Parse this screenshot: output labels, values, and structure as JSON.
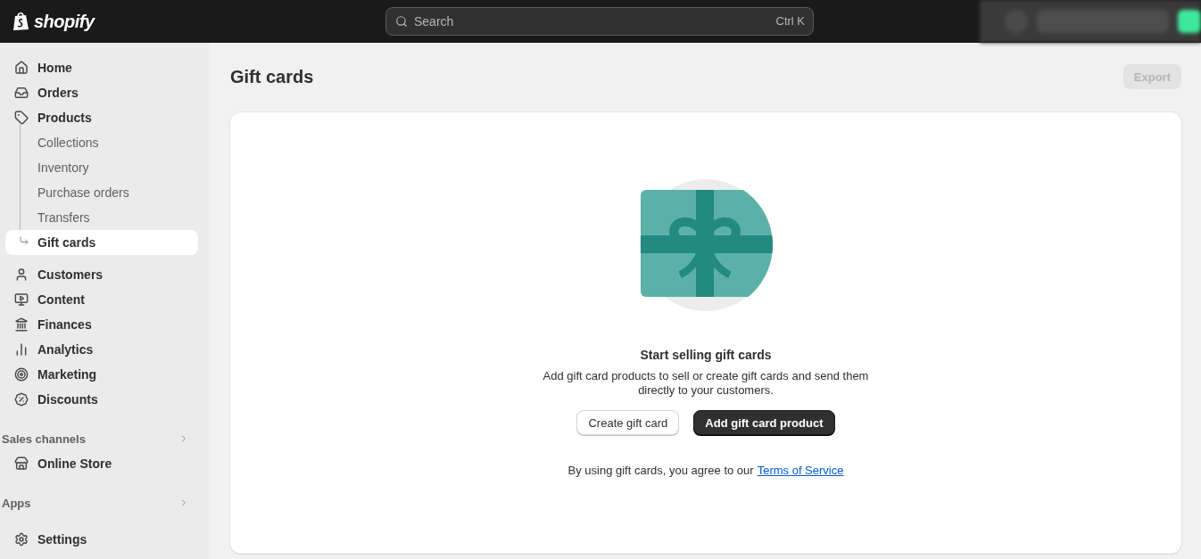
{
  "topbar": {
    "logo": "shopify",
    "search": {
      "placeholder": "Search",
      "shortcut": "Ctrl K"
    }
  },
  "sidebar": {
    "items": [
      {
        "label": "Home",
        "selected": false
      },
      {
        "label": "Orders",
        "selected": false
      },
      {
        "label": "Products",
        "selected": false,
        "children": [
          {
            "label": "Collections",
            "selected": false
          },
          {
            "label": "Inventory",
            "selected": false
          },
          {
            "label": "Purchase orders",
            "selected": false
          },
          {
            "label": "Transfers",
            "selected": false
          },
          {
            "label": "Gift cards",
            "selected": true
          }
        ]
      },
      {
        "label": "Customers",
        "selected": false
      },
      {
        "label": "Content",
        "selected": false
      },
      {
        "label": "Finances",
        "selected": false
      },
      {
        "label": "Analytics",
        "selected": false
      },
      {
        "label": "Marketing",
        "selected": false
      },
      {
        "label": "Discounts",
        "selected": false
      }
    ],
    "sections": [
      {
        "title": "Sales channels",
        "items": [
          {
            "label": "Online Store",
            "selected": false
          }
        ]
      },
      {
        "title": "Apps"
      }
    ],
    "settings": {
      "label": "Settings",
      "selected": false
    }
  },
  "page": {
    "title": "Gift cards",
    "export_button": {
      "label": "Export",
      "disabled": true
    }
  },
  "empty_state": {
    "heading": "Start selling gift cards",
    "text": "Add gift card products to sell or create gift cards and send them directly to your customers.",
    "buttons": [
      {
        "label": "Create gift card",
        "kind": "secondary"
      },
      {
        "label": "Add gift card product",
        "kind": "primary"
      }
    ],
    "terms": {
      "text": "By using gift cards, you agree to our",
      "link": "Terms of Service"
    }
  }
}
